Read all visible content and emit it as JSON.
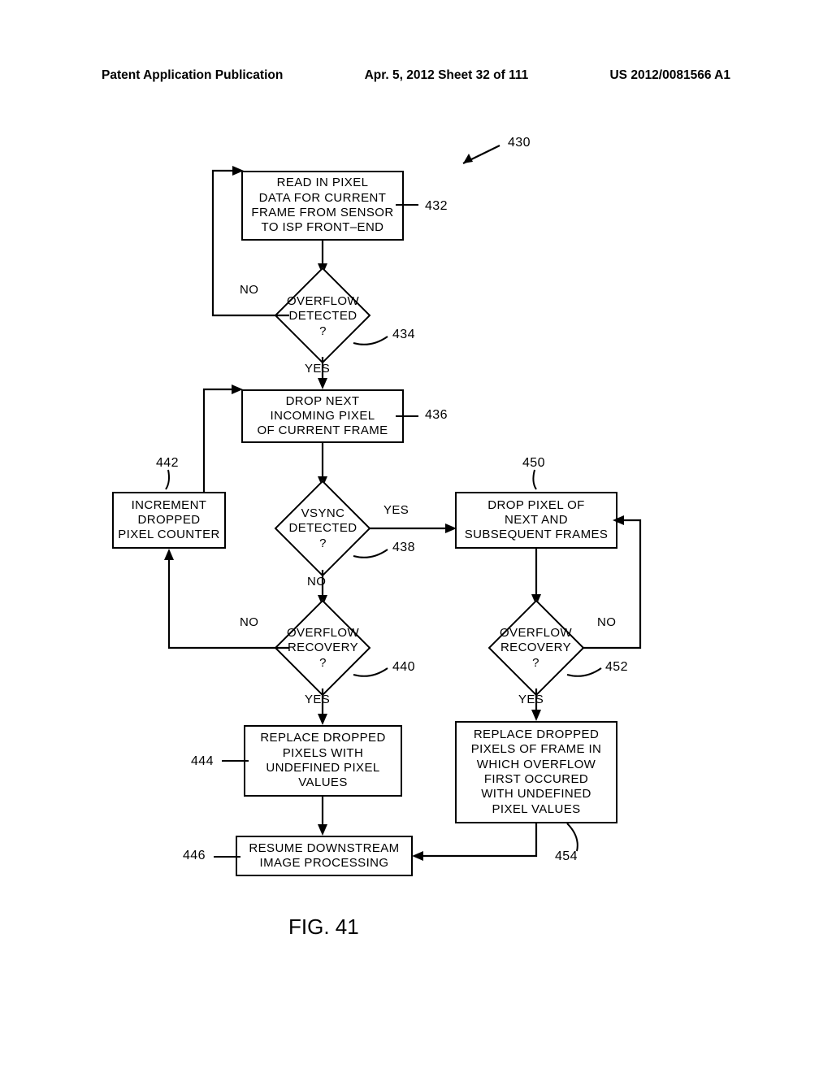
{
  "header": {
    "left": "Patent Application Publication",
    "center": "Apr. 5, 2012  Sheet 32 of 111",
    "right": "US 2012/0081566 A1"
  },
  "figure": "FIG. 41",
  "refs": {
    "r430": "430",
    "r432": "432",
    "r434": "434",
    "r436": "436",
    "r438": "438",
    "r440": "440",
    "r442": "442",
    "r444": "444",
    "r446": "446",
    "r450": "450",
    "r452": "452",
    "r454": "454"
  },
  "nodes": {
    "b432": "READ IN PIXEL\nDATA FOR CURRENT\nFRAME FROM SENSOR\nTO ISP FRONT–END",
    "d434": "OVERFLOW\nDETECTED\n?",
    "b436": "DROP NEXT\nINCOMING PIXEL\nOF CURRENT FRAME",
    "d438": "VSYNC\nDETECTED\n?",
    "d440": "OVERFLOW\nRECOVERY\n?",
    "b442": "INCREMENT\nDROPPED\nPIXEL COUNTER",
    "b444": "REPLACE DROPPED\nPIXELS WITH\nUNDEFINED PIXEL\nVALUES",
    "b446": "RESUME DOWNSTREAM\nIMAGE PROCESSING",
    "b450": "DROP PIXEL OF\nNEXT AND\nSUBSEQUENT FRAMES",
    "d452": "OVERFLOW\nRECOVERY\n?",
    "b454": "REPLACE DROPPED\nPIXELS OF FRAME IN\nWHICH OVERFLOW\nFIRST OCCURED\nWITH UNDEFINED\nPIXEL VALUES"
  },
  "labels": {
    "no": "NO",
    "yes": "YES"
  }
}
